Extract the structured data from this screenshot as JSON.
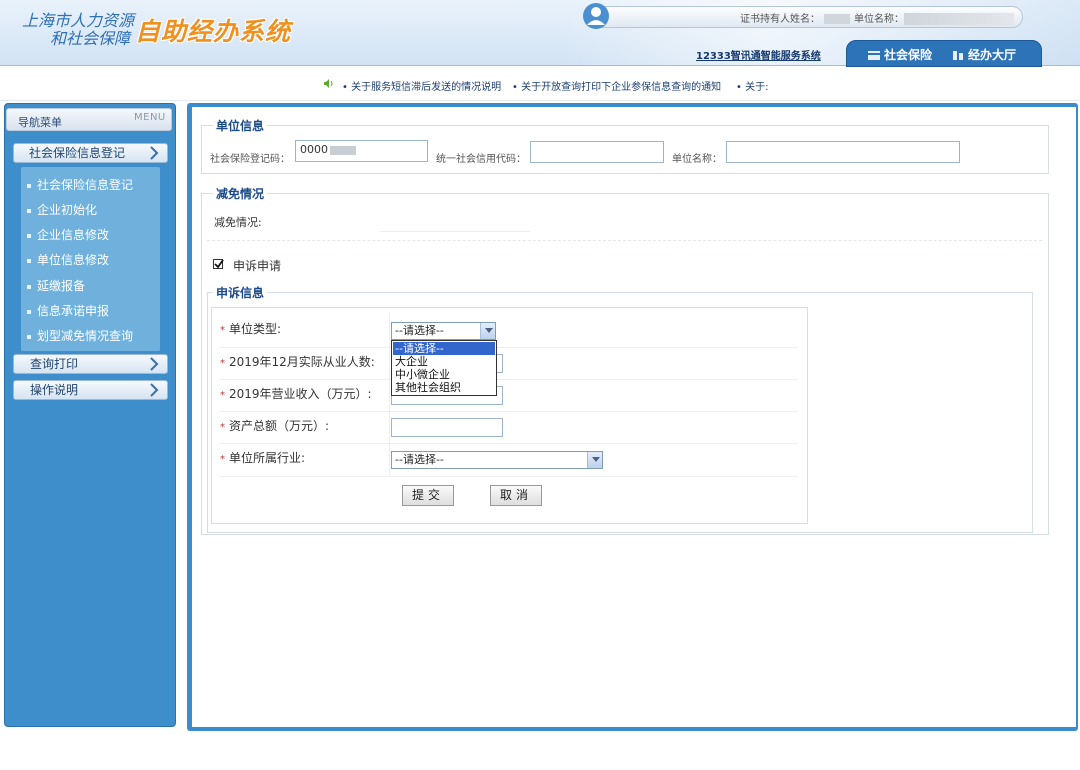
{
  "header": {
    "org_line1": "上海市人力资源",
    "org_line2": "和社会保障",
    "system_name": "自助经办系统",
    "user_label": "证书持有人姓名：",
    "unit_label": "单位名称：",
    "link_12333": "12333智讯通智能服务系统",
    "tabs": [
      {
        "label": "社会保险"
      },
      {
        "label": "经办大厅"
      }
    ],
    "icons": [
      "user-avatar-icon",
      "social-insurance-icon",
      "hall-icon"
    ]
  },
  "notice": {
    "items": [
      "• 关于服务短信滞后发送的情况说明",
      "• 关于开放查询打印下企业参保信息查询的通知",
      "• 关于:"
    ]
  },
  "sidebar": {
    "title": "导航菜单",
    "menu_tag": "MENU",
    "sections": [
      {
        "label": "社会保险信息登记"
      },
      {
        "label": "查询打印"
      },
      {
        "label": "操作说明"
      }
    ],
    "sub_items": [
      "社会保险信息登记",
      "企业初始化",
      "企业信息修改",
      "单位信息修改",
      "延缴报备",
      "信息承诺申报",
      "划型减免情况查询"
    ]
  },
  "unit_info": {
    "legend": "单位信息",
    "reg_code_label": "社会保险登记码：",
    "reg_code_value": "0000",
    "credit_code_label": "统一社会信用代码：",
    "unit_name_label": "单位名称："
  },
  "reduction": {
    "legend": "减免情况",
    "label": "减免情况:"
  },
  "appeal": {
    "checkbox_label": "申诉申请",
    "checked": true,
    "legend": "申诉信息",
    "fields": {
      "unit_type": "单位类型:",
      "employees": "2019年12月实际从业人数:",
      "revenue": "2019年营业收入（万元）:",
      "assets": "资产总额（万元）:",
      "industry": "单位所属行业:"
    },
    "unit_type_selected": "--请选择--",
    "unit_type_options": [
      "--请选择--",
      "大企业",
      "中小微企业",
      "其他社会组织"
    ],
    "industry_selected": "--请选择--",
    "submit": "提交",
    "cancel": "取消"
  }
}
